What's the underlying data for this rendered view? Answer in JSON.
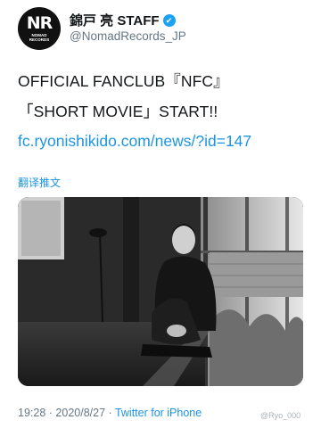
{
  "header": {
    "avatar_main": "NR",
    "avatar_sub_1": "NOMAD",
    "avatar_sub_2": "RECORDS",
    "display_name": "錦戸 亮 STAFF",
    "handle": "@NomadRecords_JP",
    "verified_icon": "verified-badge-icon"
  },
  "tweet": {
    "line1": "OFFICIAL FANCLUB『NFC』",
    "line2": "「SHORT MOVIE」START!!",
    "link": "fc.ryonishikido.com/news/?id=147",
    "translate": "翻译推文"
  },
  "footer": {
    "time": "19:28",
    "sep1": "·",
    "date": "2020/8/27",
    "sep2": "·",
    "source": "Twitter for iPhone",
    "watermark": "@Ryo_000"
  },
  "colors": {
    "link": "#1b95e0",
    "muted": "#657786",
    "verified": "#1da1f2"
  }
}
